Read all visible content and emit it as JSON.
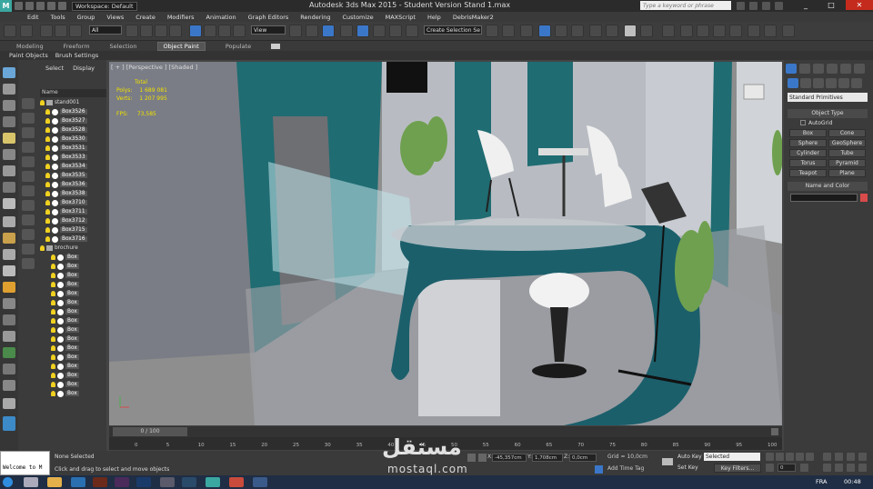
{
  "titlebar": {
    "workspace": "Workspace: Default",
    "title": "Autodesk 3ds Max  2015   - Student Version    Stand 1.max",
    "search_placeholder": "Type a keyword or phrase"
  },
  "menu": [
    "Edit",
    "Tools",
    "Group",
    "Views",
    "Create",
    "Modifiers",
    "Animation",
    "Graph Editors",
    "Rendering",
    "Customize",
    "MAXScript",
    "Help",
    "DebrisMaker2"
  ],
  "toolbar": {
    "filter_value": "All",
    "ref_coord_value": "View",
    "selection_set_value": "Create Selection Se"
  },
  "ribbon": {
    "tabs": [
      "Modeling",
      "Freeform",
      "Selection",
      "Object Paint",
      "Populate"
    ],
    "active_tab": "Object Paint",
    "sub_items": [
      "Paint Objects",
      "Brush Settings"
    ]
  },
  "explorer": {
    "tabs": [
      "Select",
      "Display"
    ],
    "column_header": "Name",
    "rows": [
      {
        "label": "stand001",
        "type": "group",
        "level": 0
      },
      {
        "label": "Box3526",
        "type": "obj",
        "level": 1
      },
      {
        "label": "Box3527",
        "type": "obj",
        "level": 1
      },
      {
        "label": "Box3528",
        "type": "obj",
        "level": 1
      },
      {
        "label": "Box3530",
        "type": "obj",
        "level": 1
      },
      {
        "label": "Box3531",
        "type": "obj",
        "level": 1
      },
      {
        "label": "Box3533",
        "type": "obj",
        "level": 1
      },
      {
        "label": "Box3534",
        "type": "obj",
        "level": 1
      },
      {
        "label": "Box3535",
        "type": "obj",
        "level": 1
      },
      {
        "label": "Box3536",
        "type": "obj",
        "level": 1
      },
      {
        "label": "Box3538",
        "type": "obj",
        "level": 1
      },
      {
        "label": "Box3710",
        "type": "obj",
        "level": 1
      },
      {
        "label": "Box3711",
        "type": "obj",
        "level": 1
      },
      {
        "label": "Box3712",
        "type": "obj",
        "level": 1
      },
      {
        "label": "Box3715",
        "type": "obj",
        "level": 1
      },
      {
        "label": "Box3716",
        "type": "obj",
        "level": 1
      },
      {
        "label": "brochure",
        "type": "group",
        "level": 0
      },
      {
        "label": "Box",
        "type": "obj",
        "level": 2
      },
      {
        "label": "Box",
        "type": "obj",
        "level": 2
      },
      {
        "label": "Box",
        "type": "obj",
        "level": 2
      },
      {
        "label": "Box",
        "type": "obj",
        "level": 2
      },
      {
        "label": "Box",
        "type": "obj",
        "level": 2
      },
      {
        "label": "Box",
        "type": "obj",
        "level": 2
      },
      {
        "label": "Box",
        "type": "obj",
        "level": 2
      },
      {
        "label": "Box",
        "type": "obj",
        "level": 2
      },
      {
        "label": "Box",
        "type": "obj",
        "level": 2
      },
      {
        "label": "Box",
        "type": "obj",
        "level": 2
      },
      {
        "label": "Box",
        "type": "obj",
        "level": 2
      },
      {
        "label": "Box",
        "type": "obj",
        "level": 2
      },
      {
        "label": "Box",
        "type": "obj",
        "level": 2
      },
      {
        "label": "Box",
        "type": "obj",
        "level": 2
      },
      {
        "label": "Box",
        "type": "obj",
        "level": 2
      },
      {
        "label": "Box",
        "type": "obj",
        "level": 2
      }
    ]
  },
  "viewport": {
    "label": "[ + ] [Perspective ] [Shaded ]",
    "stats": {
      "total_label": "Total",
      "polys_label": "Polys:",
      "polys_value": "1 689 081",
      "verts_label": "Verts:",
      "verts_value": "1 207 995",
      "fps_label": "FPS:",
      "fps_value": "73,585"
    }
  },
  "command_panel": {
    "category_value": "Standard Primitives",
    "object_type_title": "Object Type",
    "autogrid_label": "AutoGrid",
    "primitives": [
      "Box",
      "Cone",
      "Sphere",
      "GeoSphere",
      "Cylinder",
      "Tube",
      "Torus",
      "Pyramid",
      "Teapot",
      "Plane"
    ],
    "name_color_title": "Name and Color",
    "object_color": "#d84b4b"
  },
  "timeline": {
    "frame_display": "0 / 100",
    "ticks": [
      "0",
      "5",
      "10",
      "15",
      "20",
      "25",
      "30",
      "35",
      "40",
      "45",
      "50",
      "55",
      "60",
      "65",
      "70",
      "75",
      "80",
      "85",
      "90",
      "95",
      "100"
    ],
    "current_frame": 0,
    "total_frames": 100
  },
  "status": {
    "maxscript_text": "Welcome to M",
    "selection": "None Selected",
    "prompt": "Click and drag to select and move objects",
    "x_label": "X:",
    "x_value": "-45,357cm",
    "y_label": "Y:",
    "y_value": "1,708cm",
    "z_label": "Z:",
    "z_value": "0,0cm",
    "grid": "Grid = 10,0cm",
    "add_time_tag": "Add Time Tag",
    "auto_key": "Auto Key",
    "set_key": "Set Key",
    "selected_value": "Selected",
    "key_filters": "Key Filters..."
  },
  "taskbar": {
    "language": "FRA",
    "clock": "00:48"
  },
  "watermark": {
    "text": "مستقل",
    "sub": "mostaql.com"
  }
}
